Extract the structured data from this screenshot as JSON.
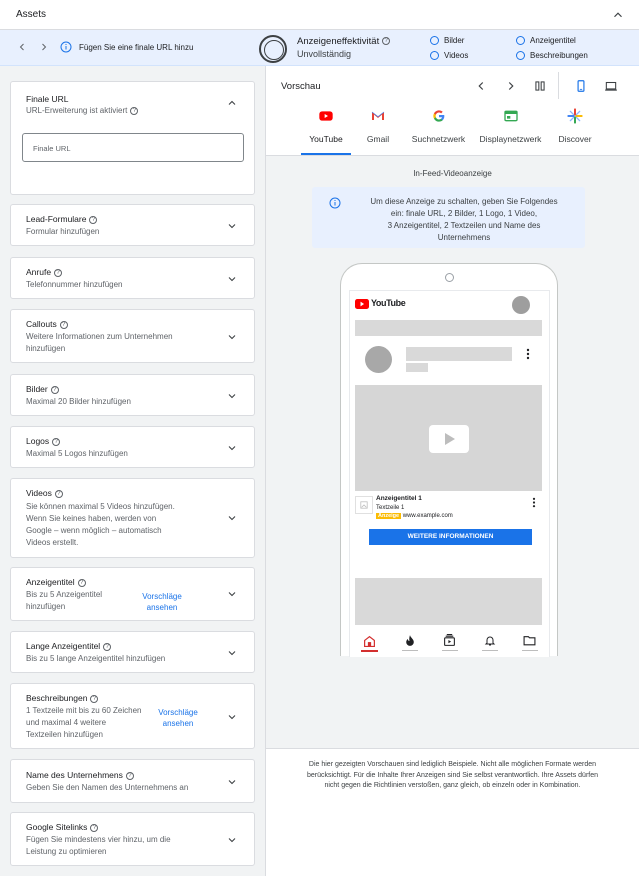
{
  "header": {
    "title": "Assets"
  },
  "bluebar": {
    "hint": "Fügen Sie eine finale URL hinzu",
    "effectiveness_title": "Anzeigeneffektivität",
    "effectiveness_status": "Unvollständig",
    "checklist": [
      "Bilder",
      "Videos",
      "Anzeigentitel",
      "Beschreibungen"
    ]
  },
  "cards": {
    "url": {
      "title": "Finale URL",
      "subtitle": "URL-Erweiterung ist aktiviert",
      "input_placeholder": "Finale URL"
    },
    "lead": {
      "title": "Lead-Formulare",
      "subtitle": "Formular hinzufügen"
    },
    "calls": {
      "title": "Anrufe",
      "subtitle": "Telefonnummer hinzufügen"
    },
    "callouts": {
      "title": "Callouts",
      "subtitle_1": "Weitere Informationen zum Unternehmen",
      "subtitle_2": "hinzufügen"
    },
    "images": {
      "title": "Bilder",
      "subtitle": "Maximal 20 Bilder hinzufügen"
    },
    "logos": {
      "title": "Logos",
      "subtitle": "Maximal 5 Logos hinzufügen"
    },
    "videos": {
      "title": "Videos",
      "lines": [
        "Sie können maximal 5 Videos hinzufügen.",
        "Wenn Sie keines haben, werden von",
        "Google – wenn möglich – automatisch",
        "Videos erstellt."
      ]
    },
    "headlines": {
      "title": "Anzeigentitel",
      "lines": [
        "Bis zu 5 Anzeigentitel",
        "hinzufügen"
      ],
      "suggest_1": "Vorschläge",
      "suggest_2": "ansehen"
    },
    "long_headlines": {
      "title": "Lange Anzeigentitel",
      "subtitle": "Bis zu 5 lange Anzeigentitel hinzufügen"
    },
    "descriptions": {
      "title": "Beschreibungen",
      "lines": [
        "1 Textzeile mit bis zu 60 Zeichen",
        "und maximal 4 weitere",
        "Textzeilen hinzufügen"
      ],
      "suggest_1": "Vorschläge",
      "suggest_2": "ansehen"
    },
    "business": {
      "title": "Name des Unternehmens",
      "subtitle": "Geben Sie den Namen des Unternehmens an"
    },
    "sitelinks": {
      "title": "Google Sitelinks",
      "subtitle_1": "Fügen Sie mindestens vier hinzu, um die",
      "subtitle_2": "Leistung zu optimieren"
    }
  },
  "preview": {
    "title": "Vorschau",
    "tabs": [
      "YouTube",
      "Gmail",
      "Suchnetzwerk",
      "Displaynetzwerk",
      "Discover"
    ],
    "feed_label": "In-Feed-Videoanzeige",
    "info_lines": [
      "Um diese Anzeige zu schalten, geben Sie Folgendes",
      "ein: finale URL, 2 Bilder, 1 Logo, 1 Video,",
      "3 Anzeigentitel, 2 Textzeilen und Name des",
      "Unternehmens"
    ],
    "ad": {
      "logo_text": "YouTube",
      "headline": "Anzeigentitel 1",
      "textline": "Textzeile 1",
      "badge": "Anzeige",
      "url": "www.example.com",
      "cta": "WEITERE INFORMATIONEN"
    },
    "disclaimer_lines": [
      "Die hier gezeigten Vorschauen sind lediglich Beispiele. Nicht alle möglichen Formate werden",
      "berücksichtigt. Für die Inhalte Ihrer Anzeigen sind Sie selbst verantwortlich. Ihre Assets dürfen",
      "nicht gegen die Richtlinien verstoßen, ganz gleich, ob einzeln oder in Kombination."
    ]
  },
  "colors": {
    "accent": "#1a73e8",
    "badge": "#fbbc04",
    "youtube_red": "#ff0000"
  }
}
